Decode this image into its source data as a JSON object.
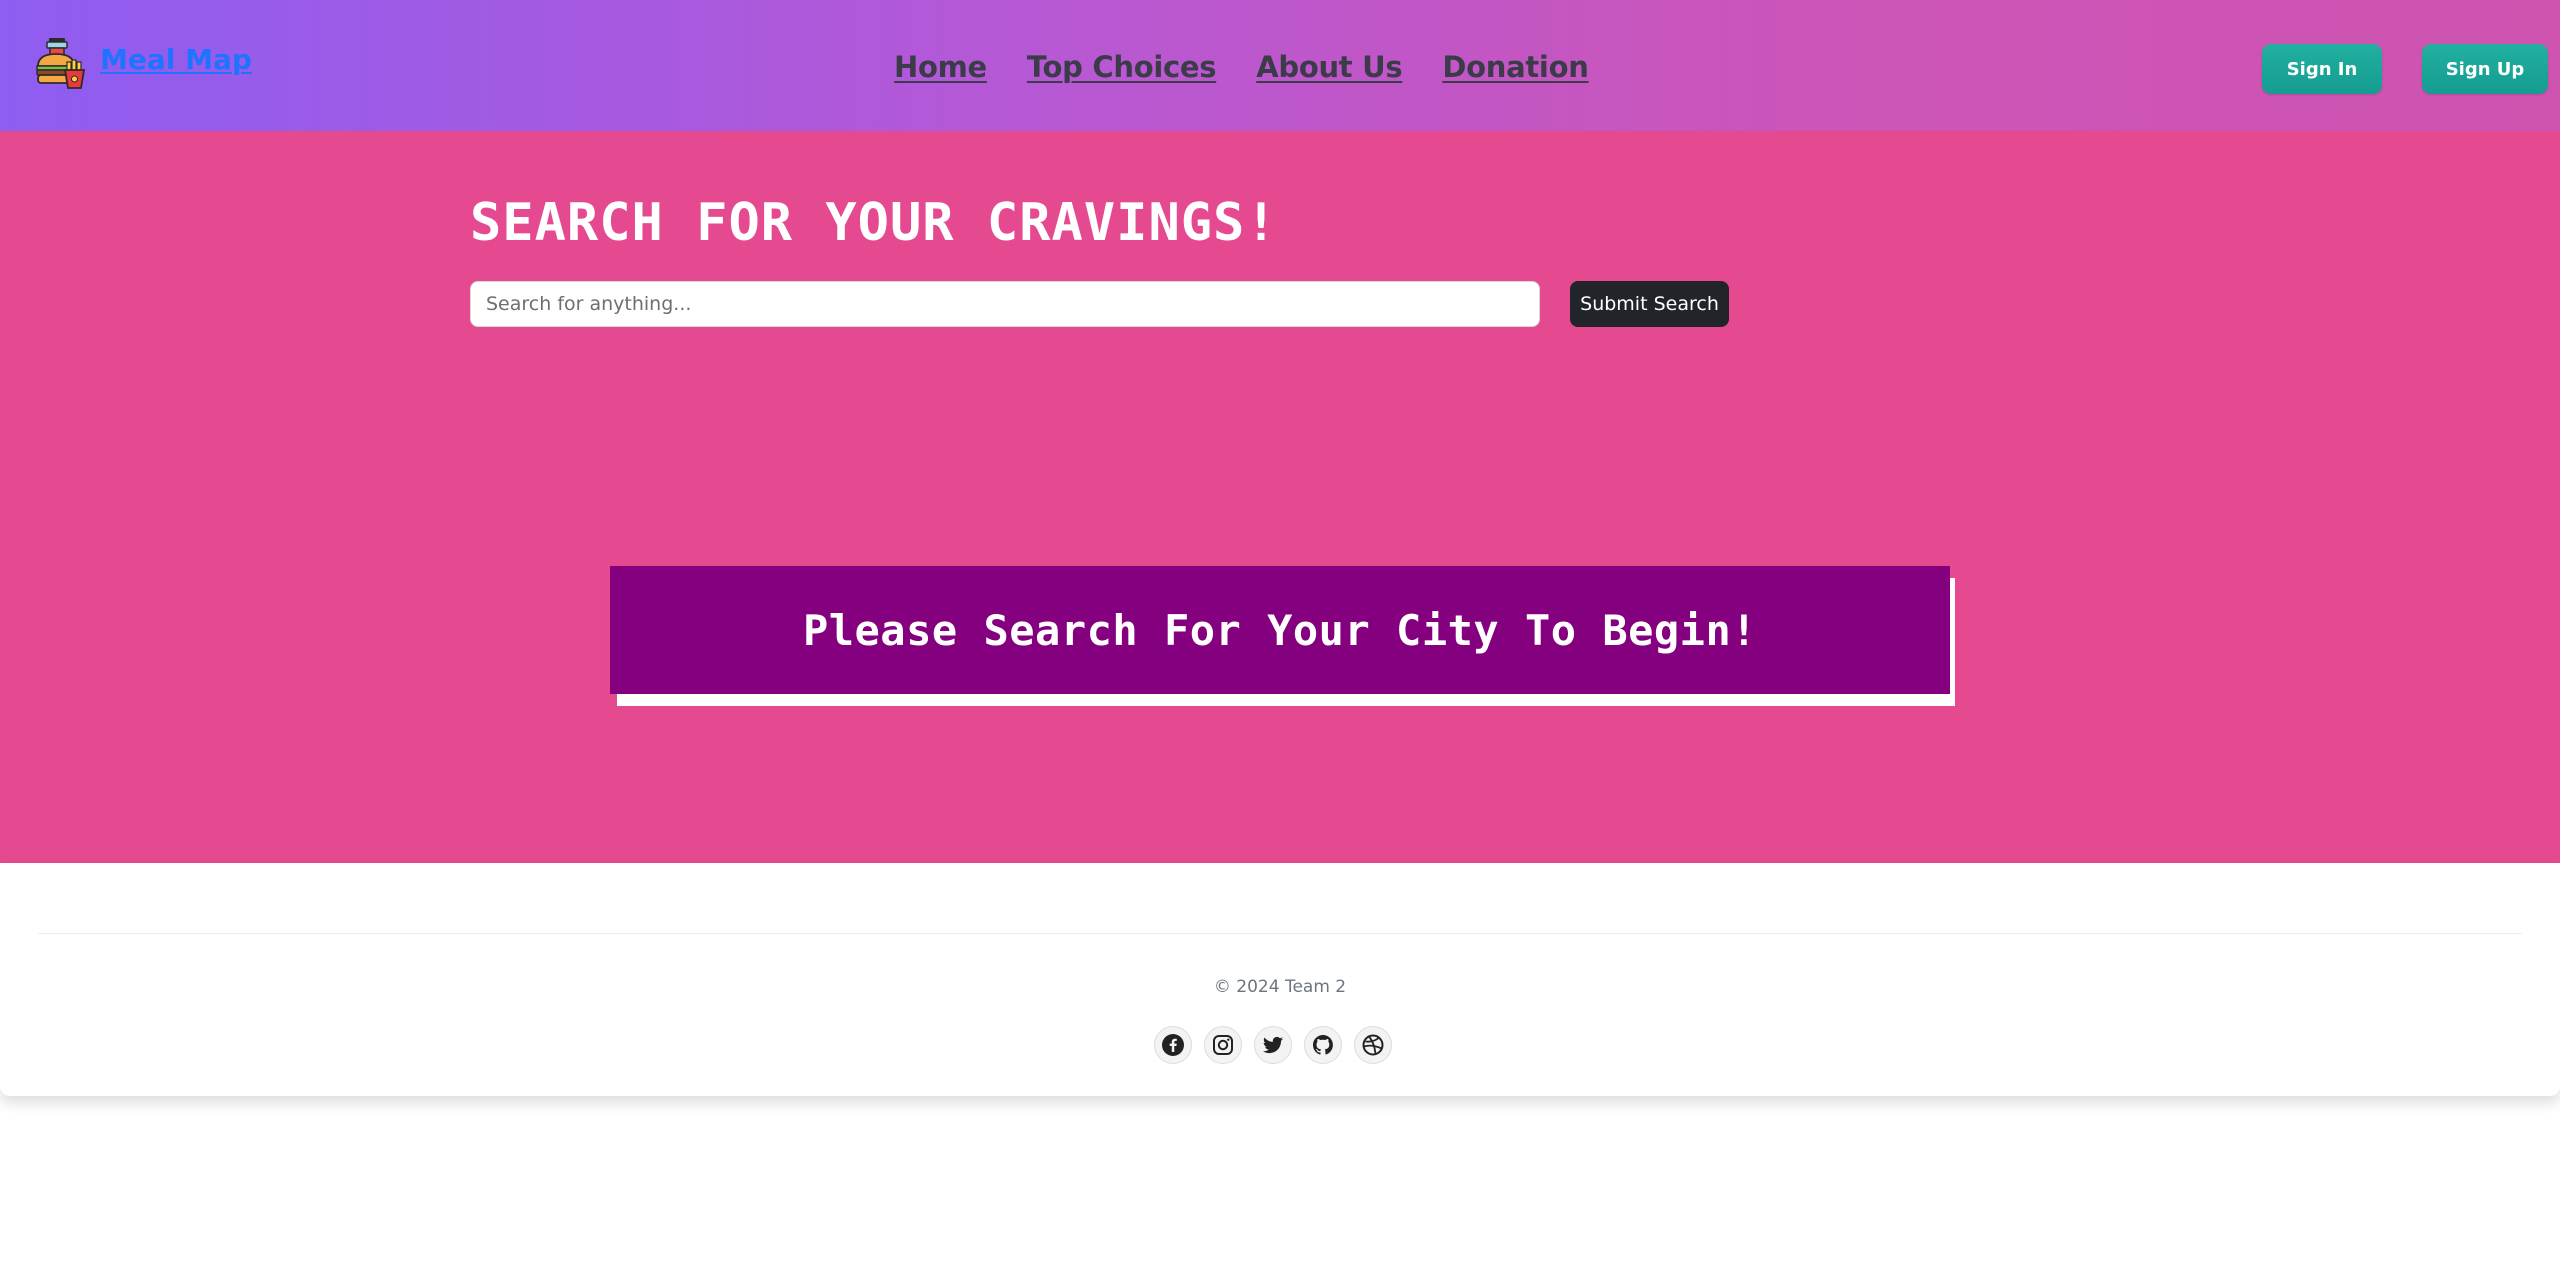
{
  "header": {
    "brand": "Meal Map",
    "nav": [
      {
        "label": "Home"
      },
      {
        "label": "Top Choices"
      },
      {
        "label": "About Us"
      },
      {
        "label": "Donation"
      }
    ],
    "sign_in": "Sign In",
    "sign_up": "Sign Up"
  },
  "hero": {
    "title": "SEARCH FOR YOUR CRAVINGS!",
    "search_placeholder": "Search for anything...",
    "search_value": "",
    "submit_label": "Submit Search",
    "banner_text": "Please Search For Your City To Begin!"
  },
  "footer": {
    "copyright": "© 2024 Team 2",
    "socials": [
      "facebook-icon",
      "instagram-icon",
      "twitter-icon",
      "github-icon",
      "dribbble-icon"
    ]
  },
  "colors": {
    "header_gradient_start": "#8e5df1",
    "header_gradient_end": "#cf54b0",
    "hero_background": "#e5498f",
    "banner_background": "#85007f",
    "auth_button": "#1aa89b",
    "submit_button": "#212529",
    "brand_link": "#1e74ff"
  }
}
